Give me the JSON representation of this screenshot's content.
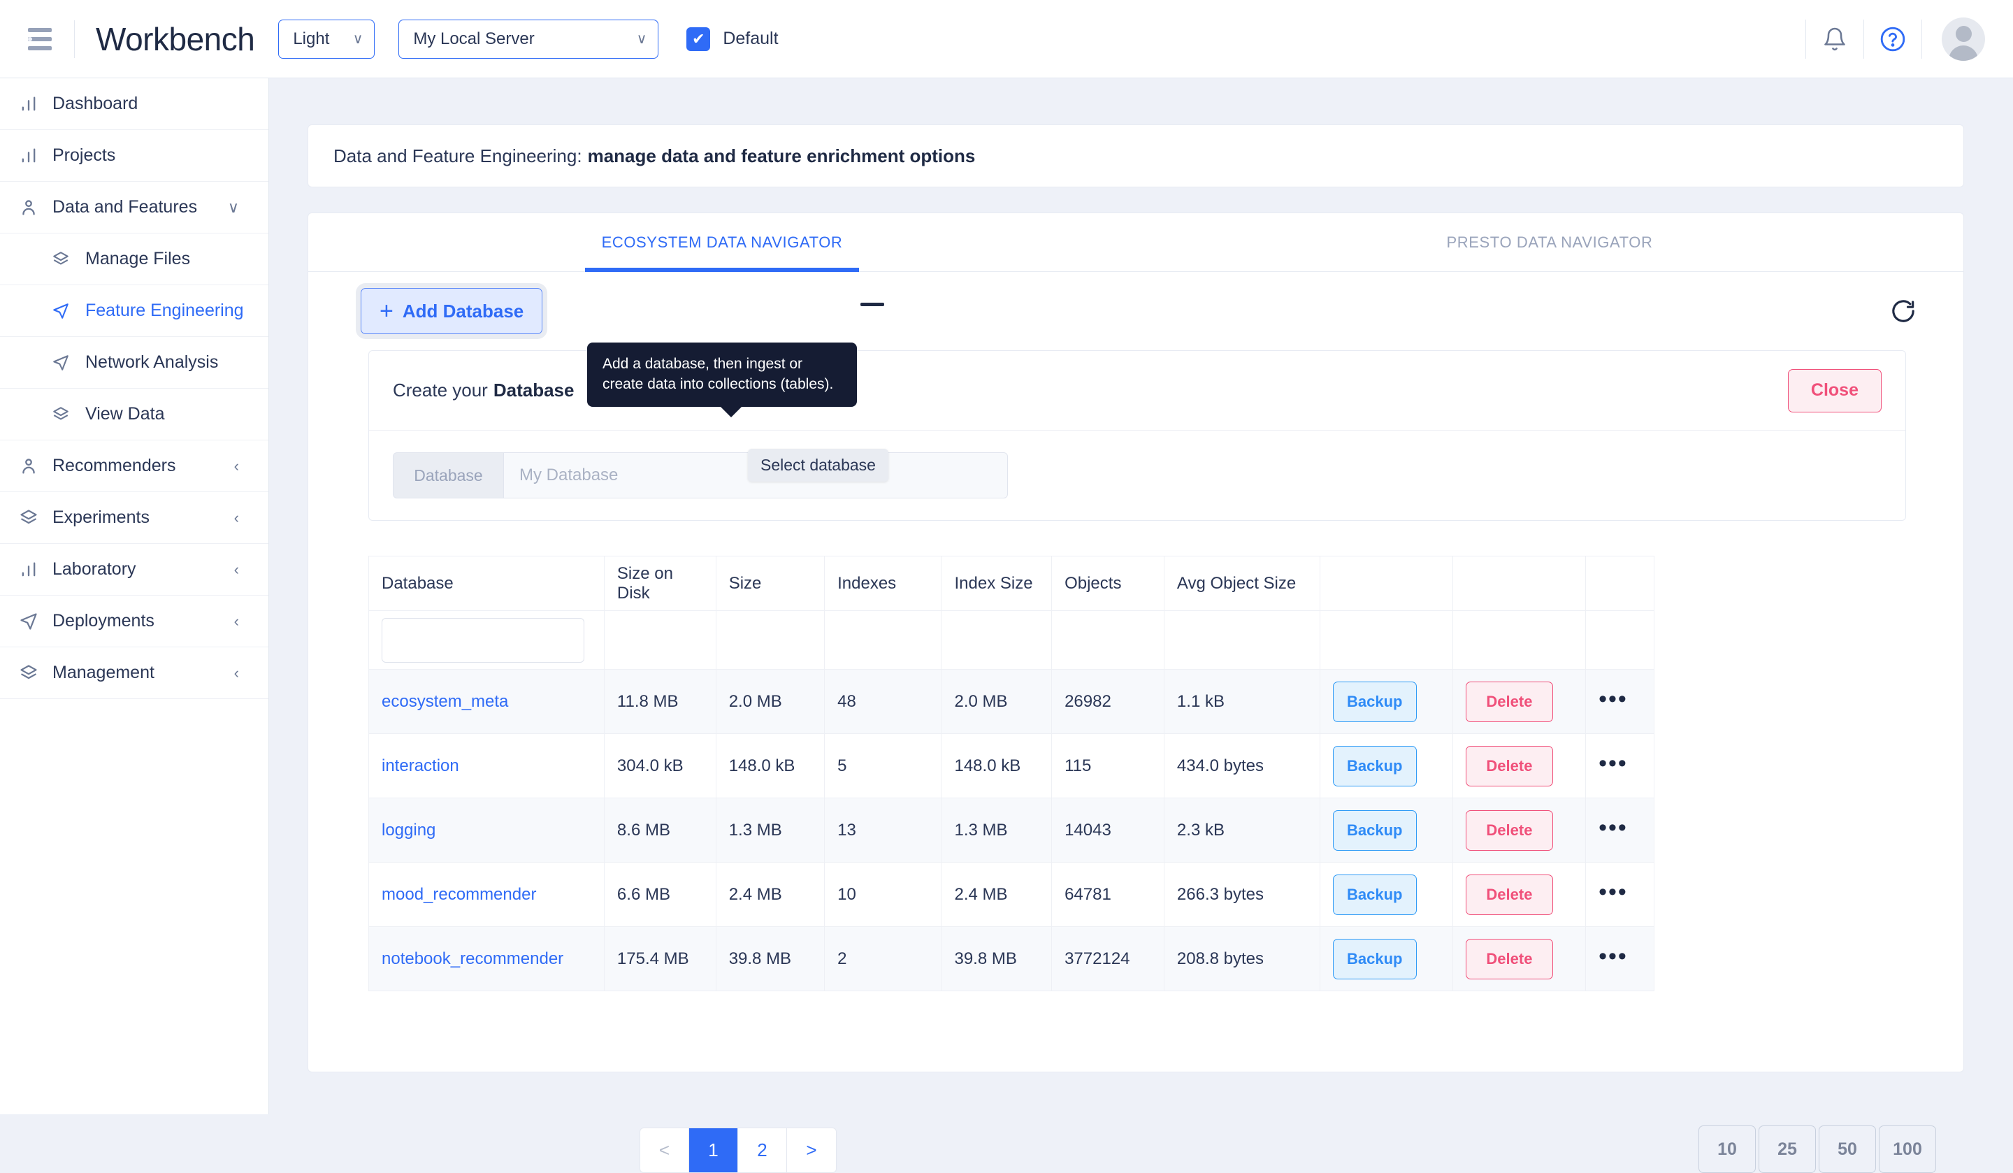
{
  "topbar": {
    "menu_icon": "hamburger-icon",
    "brand": "Workbench",
    "theme_select": {
      "value": "Light",
      "caret": "∨"
    },
    "server_select": {
      "value": "My Local Server",
      "caret": "∨"
    },
    "default_checkbox": {
      "label": "Default",
      "checked": true,
      "mark": "✔"
    },
    "bell_icon": "bell-icon",
    "help_icon": "help-circle-icon",
    "avatar": "user-avatar"
  },
  "sidebar": {
    "items": [
      {
        "label": "Dashboard",
        "icon": "bar-chart-icon",
        "chevron": ""
      },
      {
        "label": "Projects",
        "icon": "bar-chart-icon",
        "chevron": ""
      },
      {
        "label": "Data and Features",
        "icon": "user-icon",
        "chevron": "∨",
        "expanded": true
      }
    ],
    "sub_items": [
      {
        "label": "Manage Files",
        "icon": "layers-icon",
        "active": false
      },
      {
        "label": "Feature Engineering",
        "icon": "send-icon",
        "active": true
      },
      {
        "label": "Network Analysis",
        "icon": "send-icon",
        "active": false
      },
      {
        "label": "View Data",
        "icon": "layers-icon",
        "active": false
      }
    ],
    "items_bottom": [
      {
        "label": "Recommenders",
        "icon": "user-icon",
        "chevron": "‹"
      },
      {
        "label": "Experiments",
        "icon": "layers-icon",
        "chevron": "‹"
      },
      {
        "label": "Laboratory",
        "icon": "bar-chart-icon",
        "chevron": "‹"
      },
      {
        "label": "Deployments",
        "icon": "send-icon",
        "chevron": "‹"
      },
      {
        "label": "Management",
        "icon": "layers-icon",
        "chevron": "‹"
      }
    ]
  },
  "page": {
    "title_prefix": "Data and Feature Engineering:",
    "title_strong": "manage data and feature enrichment options"
  },
  "tabs": [
    {
      "label": "ECOSYSTEM DATA NAVIGATOR",
      "active": true
    },
    {
      "label": "PRESTO DATA NAVIGATOR",
      "active": false
    }
  ],
  "toolbar": {
    "add_database_label": "Add Database",
    "add_database_plus": "+",
    "collapse_icon": "minus-icon",
    "refresh_icon": "refresh-icon"
  },
  "tooltips": {
    "add_database": "Add a database, then ingest or create data into collections (tables).",
    "select_database": "Select database"
  },
  "create_panel": {
    "heading_prefix": "Create your",
    "heading_strong": "Database",
    "close_label": "Close",
    "input_addon": "Database",
    "input_placeholder": "My Database",
    "input_value": ""
  },
  "table": {
    "columns": [
      "Database",
      "Size on Disk",
      "Size",
      "Indexes",
      "Index Size",
      "Objects",
      "Avg Object Size",
      "",
      "",
      ""
    ],
    "filter_value": "",
    "filter_placeholder": "",
    "rows": [
      {
        "database": "ecosystem_meta",
        "size_on_disk": "11.8 MB",
        "size": "2.0 MB",
        "indexes": "48",
        "index_size": "2.0 MB",
        "objects": "26982",
        "avg_object_size": "1.1 kB",
        "backup": "Backup",
        "delete": "Delete",
        "more": "•••"
      },
      {
        "database": "interaction",
        "size_on_disk": "304.0 kB",
        "size": "148.0 kB",
        "indexes": "5",
        "index_size": "148.0 kB",
        "objects": "115",
        "avg_object_size": "434.0 bytes",
        "backup": "Backup",
        "delete": "Delete",
        "more": "•••"
      },
      {
        "database": "logging",
        "size_on_disk": "8.6 MB",
        "size": "1.3 MB",
        "indexes": "13",
        "index_size": "1.3 MB",
        "objects": "14043",
        "avg_object_size": "2.3 kB",
        "backup": "Backup",
        "delete": "Delete",
        "more": "•••"
      },
      {
        "database": "mood_recommender",
        "size_on_disk": "6.6 MB",
        "size": "2.4 MB",
        "indexes": "10",
        "index_size": "2.4 MB",
        "objects": "64781",
        "avg_object_size": "266.3 bytes",
        "backup": "Backup",
        "delete": "Delete",
        "more": "•••"
      },
      {
        "database": "notebook_recommender",
        "size_on_disk": "175.4 MB",
        "size": "39.8 MB",
        "indexes": "2",
        "index_size": "39.8 MB",
        "objects": "3772124",
        "avg_object_size": "208.8 bytes",
        "backup": "Backup",
        "delete": "Delete",
        "more": "•••"
      }
    ]
  },
  "pagination": {
    "prev": "<",
    "pages": [
      "1",
      "2"
    ],
    "current": "1",
    "next": ">",
    "page_sizes": [
      "10",
      "25",
      "50",
      "100"
    ]
  },
  "colors": {
    "accent": "#2f6bf6",
    "danger": "#f0507a",
    "info": "#2f8bf6",
    "text": "#2b3756",
    "muted": "#9aa4bb",
    "background": "#eef1f8"
  }
}
